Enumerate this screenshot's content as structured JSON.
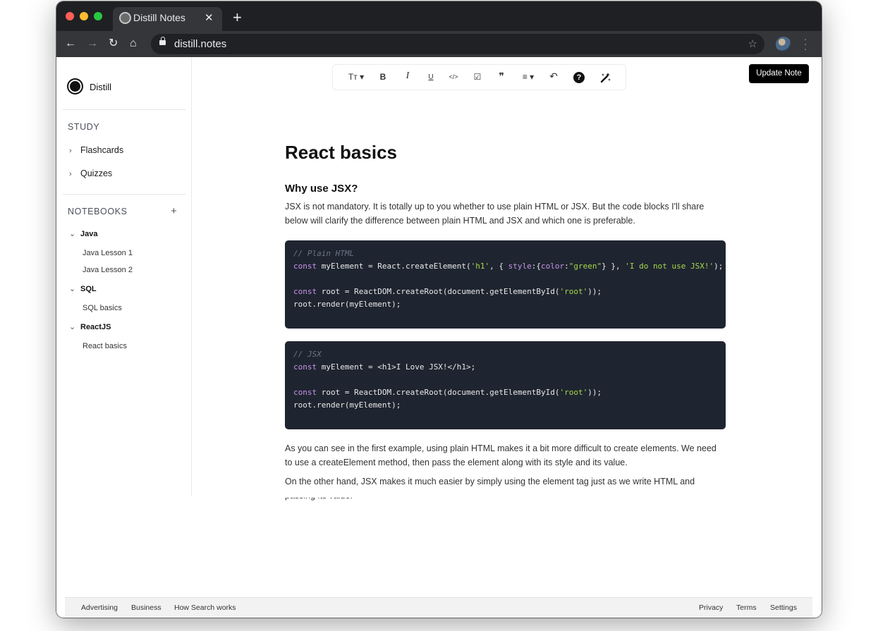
{
  "browser": {
    "tab_title": "Distill Notes",
    "url": "distill.notes"
  },
  "sidebar": {
    "brand": "Distill",
    "study": {
      "title": "STUDY",
      "items": [
        {
          "label": "Flashcards"
        },
        {
          "label": "Quizzes"
        }
      ]
    },
    "notebooks": {
      "title": "NOTEBOOKS",
      "groups": [
        {
          "name": "Java",
          "lessons": [
            "Java Lesson 1",
            "Java Lesson 2"
          ]
        },
        {
          "name": "SQL",
          "lessons": [
            "SQL basics"
          ]
        },
        {
          "name": "ReactJS",
          "lessons": [
            "React basics"
          ]
        }
      ]
    }
  },
  "editor": {
    "toolbar": {
      "text_size": "Tт",
      "bold": "B",
      "italic": "I",
      "underline": "U",
      "code": "</>",
      "checklist": "☑",
      "quote": "❞",
      "align": "≡",
      "undo": "↶",
      "help": "?"
    },
    "update_button": "Update Note",
    "title": "React basics",
    "heading": "Why use JSX?",
    "intro": "JSX is not mandatory. It is totally up to you whether to use plain HTML or JSX. But the code blocks I'll share below will clarify the difference between plain HTML and JSX and which one is preferable.",
    "code_blocks": [
      {
        "comment": "// Plain HTML",
        "line1_kw": "const",
        "line1_a": " myElement = React.createElement(",
        "line1_s1": "'h1'",
        "line1_b": ", { ",
        "line1_kw2": "style",
        "line1_c": ":{",
        "line1_kw3": "color",
        "line1_d": ":",
        "line1_s2": "\"green\"",
        "line1_e": "} }, ",
        "line1_s3": "'I do not use JSX!'",
        "line1_f": ");",
        "line3_kw": "const",
        "line3_a": " root = ReactDOM.createRoot(document.getElementById(",
        "line3_s": "'root'",
        "line3_b": "));",
        "line4": "root.render(myElement);"
      },
      {
        "comment": "// JSX",
        "line1_kw": "const",
        "line1_a": " myElement = <h1>I Love JSX!</h1>;",
        "line3_kw": "const",
        "line3_a": " root = ReactDOM.createRoot(document.getElementById(",
        "line3_s": "'root'",
        "line3_b": "));",
        "line4": "root.render(myElement);"
      }
    ],
    "para2": "As you can see in the first example, using plain HTML makes it a bit more difficult to create elements. We need to use a createElement method, then pass the element along with its style and its value.",
    "para3": "On the other hand, JSX makes it much easier by simply using the element tag just as we write HTML and passing its value."
  },
  "footer": {
    "left": [
      "Advertising",
      "Business",
      "How Search works"
    ],
    "right": [
      "Privacy",
      "Terms",
      "Settings"
    ]
  },
  "colors": {
    "code_bg": "#1f2530",
    "keyword": "#c792ea",
    "string": "#a5d64b",
    "comment": "#6b7384"
  }
}
